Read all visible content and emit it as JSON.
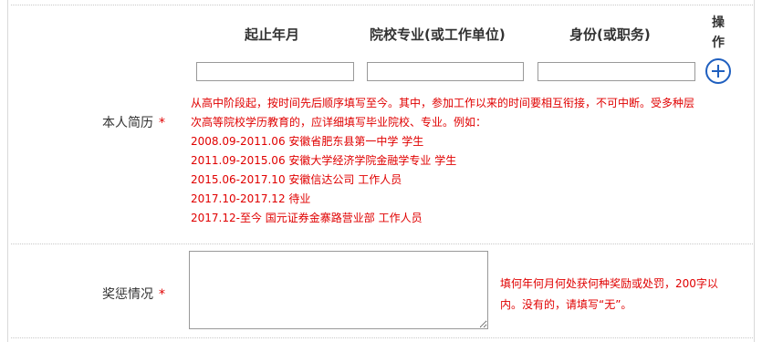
{
  "table_header": {
    "col_period": "起止年月",
    "col_school": "院校专业(或工作单位)",
    "col_role": "身份(或职务)",
    "col_op": "操作"
  },
  "resume": {
    "label": "本人简历",
    "required_mark": "*",
    "inputs": {
      "period": "",
      "school": "",
      "role": ""
    },
    "add_icon": "plus-circle-icon",
    "hint_lines": [
      "从高中阶段起，按时间先后顺序填写至今。其中，参加工作以来的时间要相互衔接，不可中断。受多种层",
      "次高等院校学历教育的，应详细填写毕业院校、专业。例如：",
      "2008.09-2011.06 安徽省肥东县第一中学 学生",
      "2011.09-2015.06 安徽大学经济学院金融学专业 学生",
      "2015.06-2017.10 安徽信达公司 工作人员",
      "2017.10-2017.12 待业",
      "2017.12-至今 国元证券金寨路营业部 工作人员"
    ]
  },
  "rewards": {
    "label": "奖惩情况",
    "required_mark": "*",
    "value": "",
    "hint_lines": [
      "填何年何月何处获何种奖励或处罚，200字以",
      "内。没有的，请填写“无”。"
    ]
  },
  "colors": {
    "required": "#e00000",
    "accent": "#1f5fbf",
    "border": "#999999"
  }
}
